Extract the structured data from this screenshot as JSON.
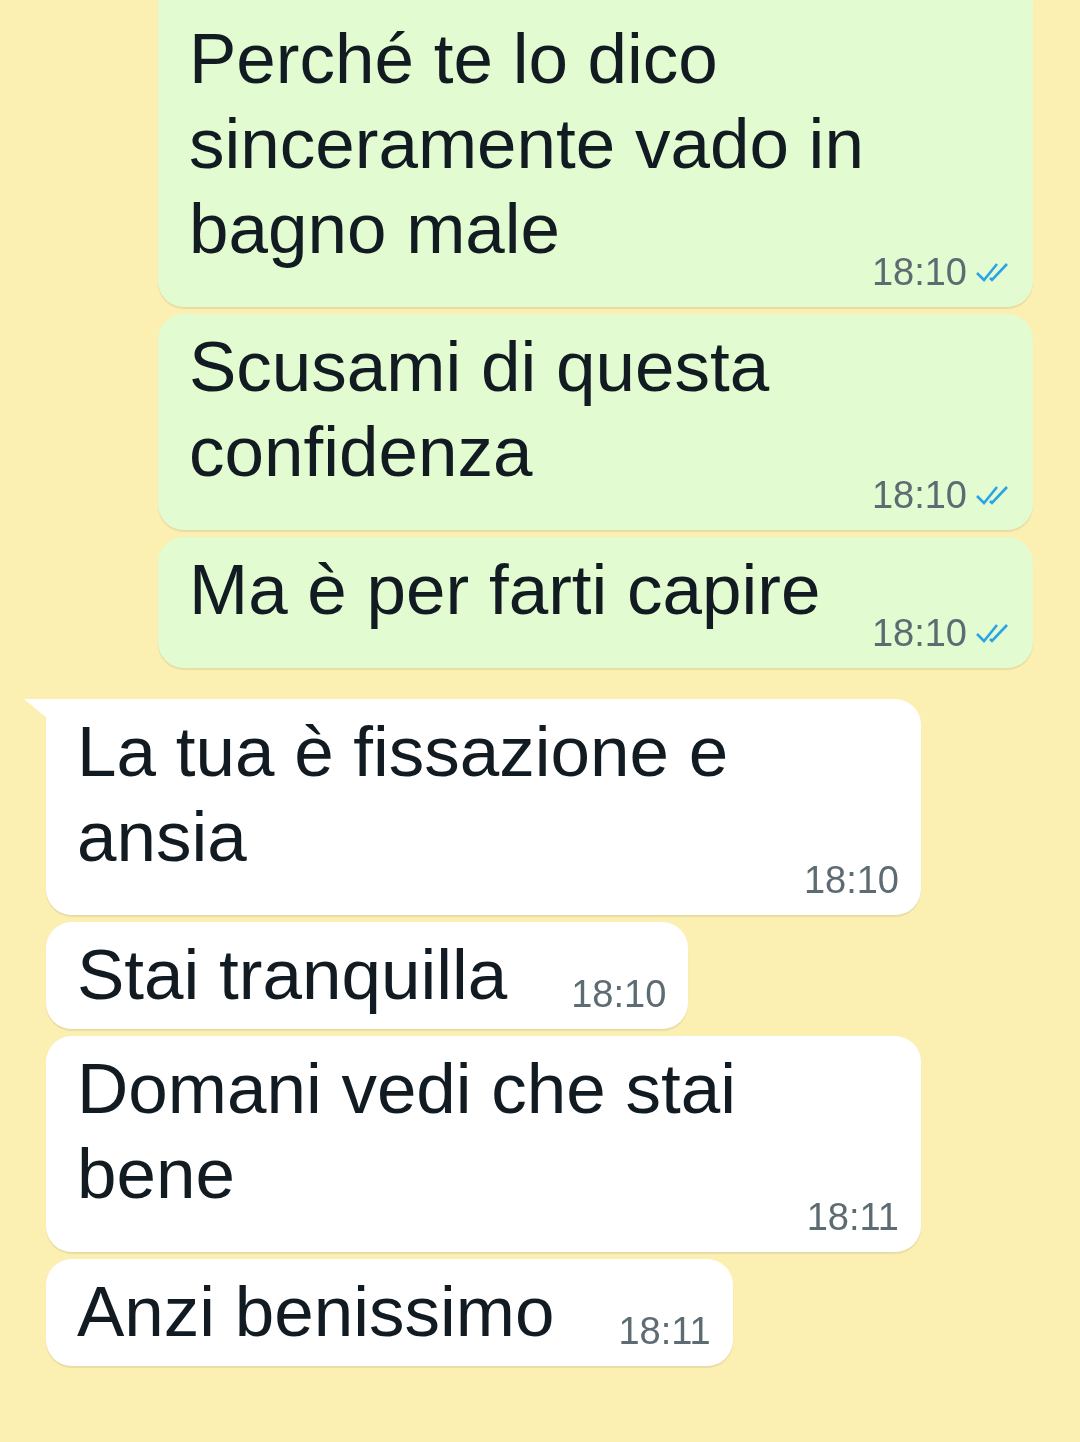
{
  "messages": [
    {
      "kind": "outgoing",
      "text": "Perché te lo dico sinceramente vado in bagno male",
      "time": "18:10",
      "read": true,
      "tail": false
    },
    {
      "kind": "outgoing",
      "text": "Scusami di questa confidenza",
      "time": "18:10",
      "read": true,
      "tail": false
    },
    {
      "kind": "outgoing",
      "text": "Ma è per farti capire",
      "time": "18:10",
      "read": true,
      "tail": false
    },
    {
      "kind": "incoming",
      "text": "La tua è fissazione e ansia",
      "time": "18:10",
      "tail": true
    },
    {
      "kind": "incoming",
      "text": "Stai tranquilla",
      "time": "18:10",
      "tail": false
    },
    {
      "kind": "incoming",
      "text": "Domani vedi che stai bene",
      "time": "18:11",
      "tail": false
    },
    {
      "kind": "incoming",
      "text": "Anzi benissimo",
      "time": "18:11",
      "tail": false
    }
  ]
}
